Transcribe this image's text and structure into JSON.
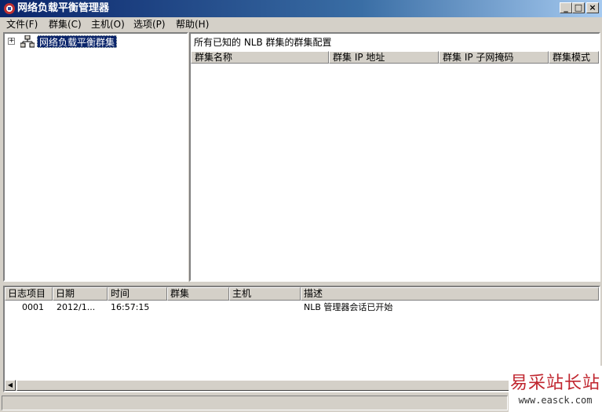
{
  "window": {
    "title": "网络负载平衡管理器"
  },
  "caption_buttons": {
    "minimize": "_",
    "maximize": "□",
    "close": "×"
  },
  "menu": [
    {
      "label": "文件(F)"
    },
    {
      "label": "群集(C)"
    },
    {
      "label": "主机(O)"
    },
    {
      "label": "选项(P)"
    },
    {
      "label": "帮助(H)"
    }
  ],
  "tree": {
    "expander": "+",
    "root_label": "网络负载平衡群集"
  },
  "cluster_view": {
    "caption": "所有已知的 NLB 群集的群集配置",
    "columns": [
      "群集名称",
      "群集 IP 地址",
      "群集 IP 子网掩码",
      "群集模式"
    ]
  },
  "log": {
    "columns": [
      "日志项目",
      "日期",
      "时间",
      "群集",
      "主机",
      "描述"
    ],
    "rows": [
      {
        "entry": "0001",
        "date": "2012/1...",
        "time": "16:57:15",
        "cluster": "",
        "host": "",
        "description": "NLB 管理器会话已开始"
      }
    ]
  },
  "scrollbar": {
    "left_arrow": "◀"
  },
  "watermark": {
    "text": "易采站长站",
    "url": "www.easck.com"
  },
  "colors": {
    "titlebar": "#0a246a",
    "selection": "#0a246a",
    "watermark": "#c0262f"
  }
}
